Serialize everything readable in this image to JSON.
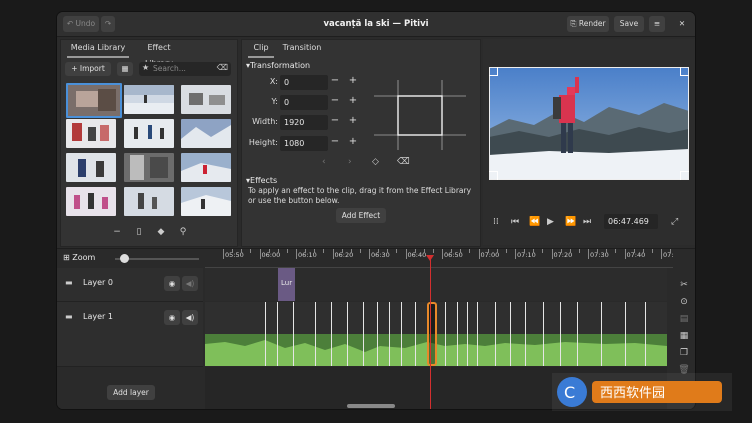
{
  "window": {
    "title": "vacanță la ski — Pitivi"
  },
  "header": {
    "undo_label": "Undo",
    "redo_icon": "redo-icon",
    "render_label": "Render",
    "save_label": "Save",
    "menu_icon": "hamburger-menu-icon",
    "close_icon": "close-icon"
  },
  "library": {
    "tabs": [
      "Media Library",
      "Effect Library"
    ],
    "import_label": "Import",
    "search_placeholder": "Search...",
    "thumbnails": [
      "thumb-1",
      "thumb-2",
      "thumb-3",
      "thumb-4",
      "thumb-5",
      "thumb-6",
      "thumb-7",
      "thumb-8",
      "thumb-9",
      "thumb-10",
      "thumb-11",
      "thumb-12"
    ]
  },
  "clip_panel": {
    "tabs": [
      "Clip",
      "Transition"
    ],
    "transformation_label": "Transformation",
    "fields": [
      {
        "label": "X:",
        "value": "0"
      },
      {
        "label": "Y:",
        "value": "0"
      },
      {
        "label": "Width:",
        "value": "1920"
      },
      {
        "label": "Height:",
        "value": "1080"
      }
    ],
    "effects_label": "Effects",
    "effects_hint": "To apply an effect to the clip, drag it from the Effect Library or use the button below.",
    "add_effect_label": "Add Effect"
  },
  "viewer": {
    "timecode": "06:47.469"
  },
  "timeline": {
    "zoom_label": "Zoom",
    "ruler_labels": [
      "05:50",
      "06:00",
      "06:10",
      "06:20",
      "06:30",
      "06:40",
      "06:50",
      "07:00",
      "07:10",
      "07:20",
      "07:30",
      "07:40",
      "07:50"
    ],
    "layers": [
      {
        "name": "Layer 0"
      },
      {
        "name": "Layer 1"
      }
    ],
    "clip_label": "Lur",
    "add_layer_label": "Add layer"
  },
  "colors": {
    "accent": "#e8892a",
    "playhead": "#d32f2f",
    "audio": "#7fbf5a",
    "clip_purple": "#6a5a84"
  }
}
